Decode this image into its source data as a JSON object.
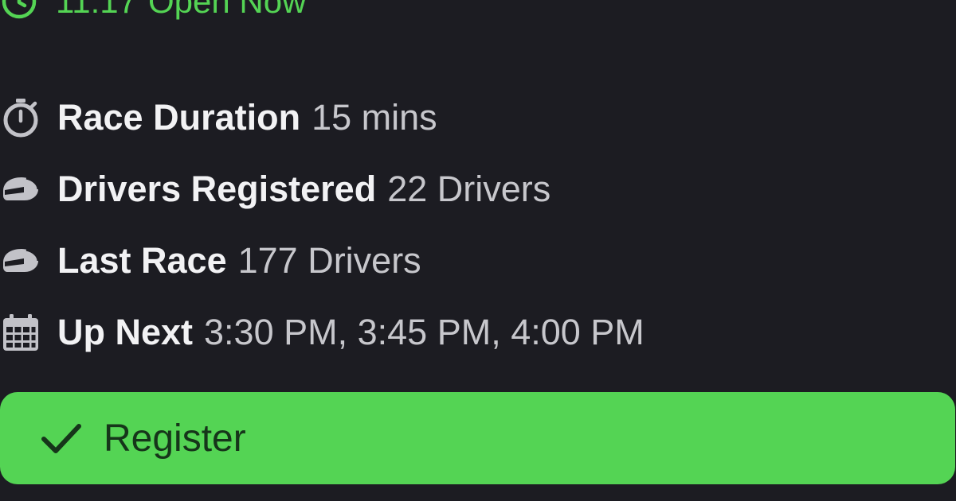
{
  "status": {
    "time": "11:17",
    "text": "Open Now",
    "icon": "clock-icon",
    "color": "#54d454"
  },
  "rows": [
    {
      "icon": "stopwatch-icon",
      "label": "Race Duration",
      "value": "15 mins"
    },
    {
      "icon": "helmet-icon",
      "label": "Drivers Registered",
      "value": "22 Drivers"
    },
    {
      "icon": "helmet-icon",
      "label": "Last Race",
      "value": "177 Drivers"
    },
    {
      "icon": "calendar-icon",
      "label": "Up Next",
      "value": "3:30 PM, 3:45 PM, 4:00 PM"
    }
  ],
  "register_button": {
    "label": "Register",
    "icon": "check-icon",
    "color": "#54d454"
  },
  "theme": {
    "background": "#1c1c22",
    "label_color": "#f2f2f4",
    "value_color": "#c7c7cc",
    "icon_color": "#c2c2c8"
  }
}
